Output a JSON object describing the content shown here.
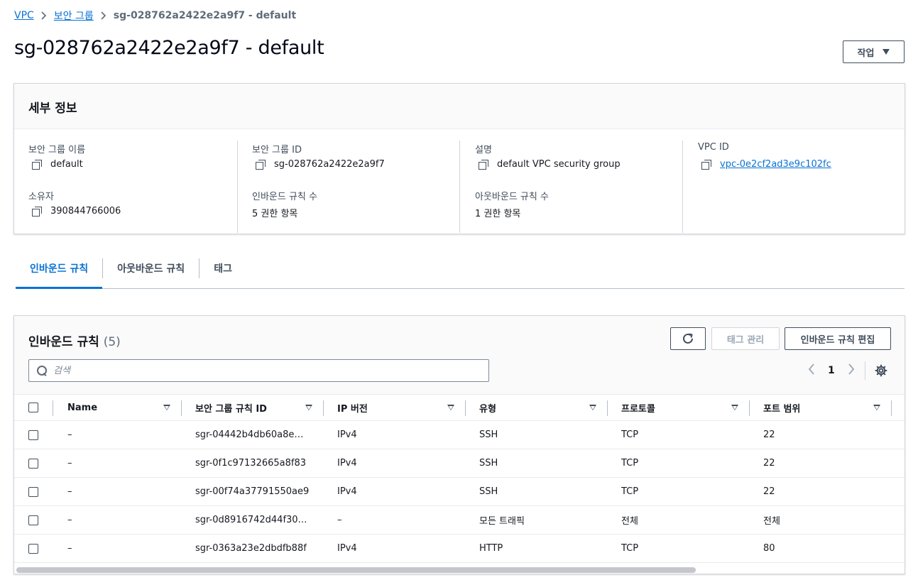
{
  "breadcrumb": {
    "items": [
      "VPC",
      "보안 그룹"
    ],
    "current": "sg-028762a2422e2a9f7 - default"
  },
  "page": {
    "title": "sg-028762a2422e2a9f7 - default",
    "actions_label": "작업"
  },
  "details": {
    "title": "세부 정보",
    "fields": {
      "sg_name": {
        "label": "보안 그룹 이름",
        "value": "default"
      },
      "sg_id": {
        "label": "보안 그룹 ID",
        "value": "sg-028762a2422e2a9f7"
      },
      "description": {
        "label": "설명",
        "value": "default VPC security group"
      },
      "vpc_id": {
        "label": "VPC ID",
        "value": "vpc-0e2cf2ad3e9c102fc"
      },
      "owner": {
        "label": "소유자",
        "value": "390844766006"
      },
      "inbound_count": {
        "label": "인바운드 규칙 수",
        "value": "5 권한 항목"
      },
      "outbound_count": {
        "label": "아웃바운드 규칙 수",
        "value": "1 권한 항목"
      }
    }
  },
  "tabs": [
    "인바운드 규칙",
    "아웃바운드 규칙",
    "태그"
  ],
  "rules": {
    "title": "인바운드 규칙",
    "count": "(5)",
    "manage_tags_label": "태그 관리",
    "edit_label": "인바운드 규칙 편집",
    "search_placeholder": "검색",
    "page_number": "1",
    "columns": [
      "Name",
      "보안 그룹 규칙 ID",
      "IP 버전",
      "유형",
      "프로토콜",
      "포트 범위"
    ],
    "rows": [
      [
        "–",
        "sgr-04442b4db60a8e…",
        "IPv4",
        "SSH",
        "TCP",
        "22"
      ],
      [
        "–",
        "sgr-0f1c97132665a8f83",
        "IPv4",
        "SSH",
        "TCP",
        "22"
      ],
      [
        "–",
        "sgr-00f74a37791550ae9",
        "IPv4",
        "SSH",
        "TCP",
        "22"
      ],
      [
        "–",
        "sgr-0d8916742d44f30…",
        "–",
        "모든 트래픽",
        "전체",
        "전체"
      ],
      [
        "–",
        "sgr-0363a23e2dbdfb88f",
        "IPv4",
        "HTTP",
        "TCP",
        "80"
      ]
    ]
  },
  "colors": {
    "link": "#0972d3",
    "text": "#16191f",
    "border": "#d1d5db"
  }
}
